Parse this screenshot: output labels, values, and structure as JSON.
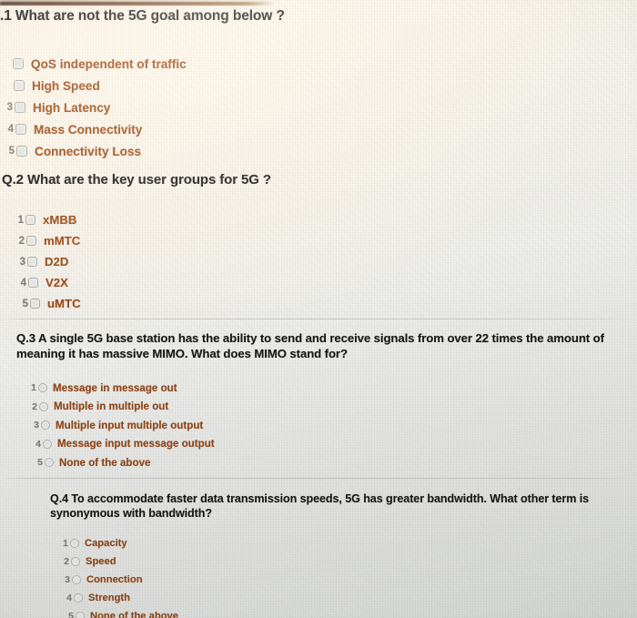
{
  "media": {
    "kind": "photograph-of-screen",
    "top_edge_color": "#5b3722",
    "question_text_color": "#161616",
    "option_text_color": "#9c4a16",
    "option_number_color": "#7d7d7a",
    "paper_light_color": "#fbf7ef",
    "paper_shadow_color": "#d3d5d3"
  },
  "questions": [
    {
      "id": "q1",
      "number": "1",
      "text": ".1 What are not the 5G goal among below ?",
      "control": "checkbox",
      "options": [
        {
          "num": "",
          "label": "QoS independent of traffic"
        },
        {
          "num": "",
          "label": "High Speed"
        },
        {
          "num": "3",
          "label": "High Latency"
        },
        {
          "num": "4",
          "label": "Mass Connectivity"
        },
        {
          "num": "5",
          "label": "Connectivity Loss"
        }
      ]
    },
    {
      "id": "q2",
      "number": "2",
      "text": "Q.2 What are the key user groups for 5G ?",
      "control": "checkbox",
      "options": [
        {
          "num": "1",
          "label": "xMBB"
        },
        {
          "num": "2",
          "label": "mMTC"
        },
        {
          "num": "3",
          "label": "D2D"
        },
        {
          "num": "4",
          "label": "V2X"
        },
        {
          "num": "5",
          "label": "uMTC"
        }
      ]
    },
    {
      "id": "q3",
      "number": "3",
      "text_line1": "Q.3 A single 5G base station has the ability to send and receive signals from over 22 times the amount of",
      "text_line2": "meaning it has massive MIMO. What does MIMO stand for?",
      "control": "radio",
      "options": [
        {
          "num": "1",
          "label": "Message in message out"
        },
        {
          "num": "2",
          "label": "Multiple in multiple out"
        },
        {
          "num": "3",
          "label": "Multiple input multiple output"
        },
        {
          "num": "4",
          "label": "Message input message output"
        },
        {
          "num": "5",
          "label": "None of the above"
        }
      ]
    },
    {
      "id": "q4",
      "number": "4",
      "text_line1": "Q.4 To accommodate faster data transmission speeds, 5G has greater bandwidth. What other term is",
      "text_line2": "synonymous with bandwidth?",
      "control": "radio",
      "options": [
        {
          "num": "1",
          "label": "Capacity"
        },
        {
          "num": "2",
          "label": "Speed"
        },
        {
          "num": "3",
          "label": "Connection"
        },
        {
          "num": "4",
          "label": "Strength"
        },
        {
          "num": "5",
          "label": "None of the above"
        }
      ]
    }
  ]
}
